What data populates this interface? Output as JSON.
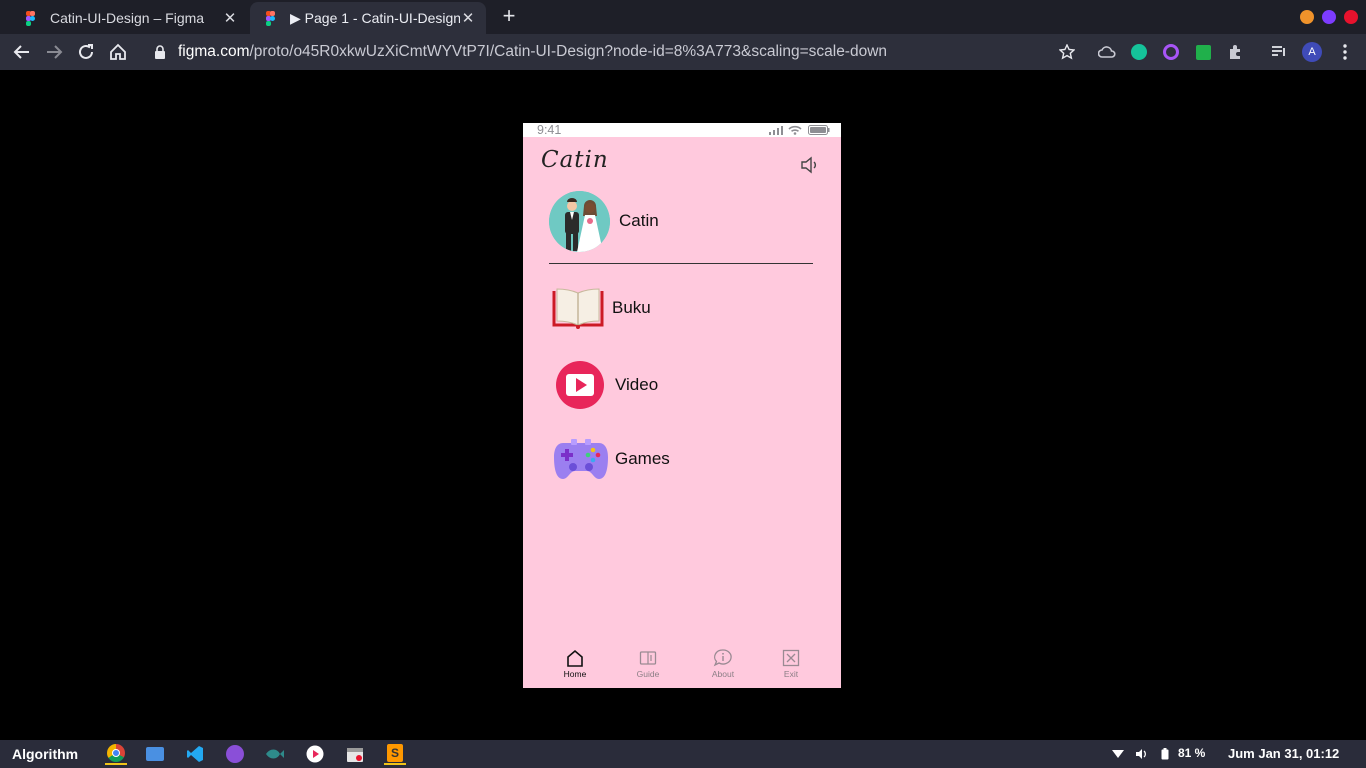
{
  "browser": {
    "tabs": [
      {
        "title": "Catin-UI-Design – Figma",
        "close": "✕",
        "active": false
      },
      {
        "title": "▶ Page 1 - Catin-UI-Design",
        "close": "✕",
        "active": true
      }
    ],
    "new_tab": "+",
    "url_host": "figma.com",
    "url_path": "/proto/o45R0xkwUzXiCmtWYVtP7I/Catin-UI-Design?node-id=8%3A773&scaling=scale-down",
    "profile_initial": "A",
    "colors": {
      "tabbar": "#1e1f28",
      "toolbar": "#2d2f3b",
      "win_min": "#f0932b",
      "win_max": "#7d3cff",
      "win_close": "#e8122d"
    }
  },
  "app": {
    "status_time": "9:41",
    "logo": "Catin",
    "profile": {
      "name": "Catin",
      "avatar_icon": "bride-groom-icon"
    },
    "menu": [
      {
        "label": "Buku",
        "icon": "book-icon"
      },
      {
        "label": "Video",
        "icon": "play-video-icon"
      },
      {
        "label": "Games",
        "icon": "gamepad-icon"
      }
    ],
    "bottom_nav": [
      {
        "label": "Home",
        "icon": "home-icon",
        "active": true
      },
      {
        "label": "Guide",
        "icon": "guide-book-icon",
        "active": false
      },
      {
        "label": "About",
        "icon": "info-bubble-icon",
        "active": false
      },
      {
        "label": "Exit",
        "icon": "exit-x-icon",
        "active": false
      }
    ],
    "colors": {
      "background": "#ffc9dd",
      "video_red": "#e8265a",
      "book_red": "#cc1a25",
      "gamepad": "#9b7ff0"
    }
  },
  "taskbar": {
    "title": "Algorithm",
    "battery": "81 %",
    "clock": "Jum Jan 31, 01:12"
  }
}
